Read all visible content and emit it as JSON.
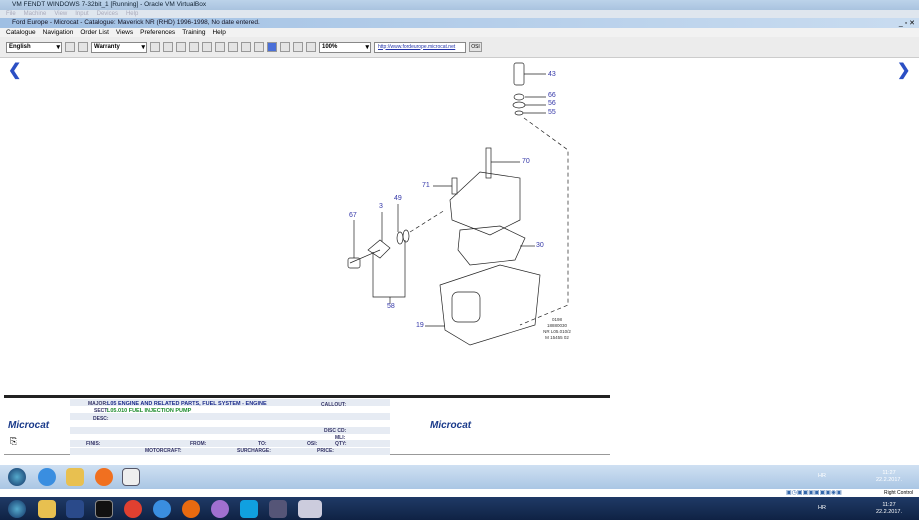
{
  "vm_title": "VM FENDT WINDOWS 7-32bit_1 [Running] - Oracle VM VirtualBox",
  "vm_menu": [
    "File",
    "Machine",
    "View",
    "Input",
    "Devices",
    "Help"
  ],
  "app_title": "Ford Europe - Microcat - Catalogue: Maverick NR (RHD) 1996-1998, No date entered.",
  "app_menu": [
    "Catalogue",
    "Navigation",
    "Order List",
    "Views",
    "Preferences",
    "Training",
    "Help"
  ],
  "toolbar": {
    "language": "English",
    "mode": "Warranty",
    "zoom": "100%",
    "url": "http://www.fordeurope.microcat.net",
    "osi": "OSI"
  },
  "diagram": {
    "callouts": [
      "43",
      "66",
      "56",
      "55",
      "70",
      "71",
      "49",
      "3",
      "67",
      "30",
      "58",
      "19"
    ],
    "ref": [
      "0198",
      "18880030",
      "NR L05.010/2",
      "M 15455 02"
    ]
  },
  "info": {
    "major_label": "MAJOR:",
    "major_value": "L05  ENGINE AND RELATED PARTS, FUEL SYSTEM - ENGINE",
    "sect_label": "SECT:",
    "sect_value": "L05.010   FUEL INJECTION PUMP",
    "desc_label": "DESC:",
    "callout_label": "CALLOUT:",
    "disc_label": "DISC CD:",
    "mli_label": "MLI:",
    "finis_label": "FINIS:",
    "from_label": "FROM:",
    "to_label": "TO:",
    "osi_label": "OSI:",
    "qty_label": "QTY:",
    "motorcraft_label": "MOTORCRAFT:",
    "surcharge_label": "SURCHARGE:",
    "price_label": "PRICE:",
    "logo": "Microcat"
  },
  "tray": {
    "lang": "HR",
    "time": "11:27",
    "date": "22.2.2017.",
    "host_key": "Right Control"
  }
}
